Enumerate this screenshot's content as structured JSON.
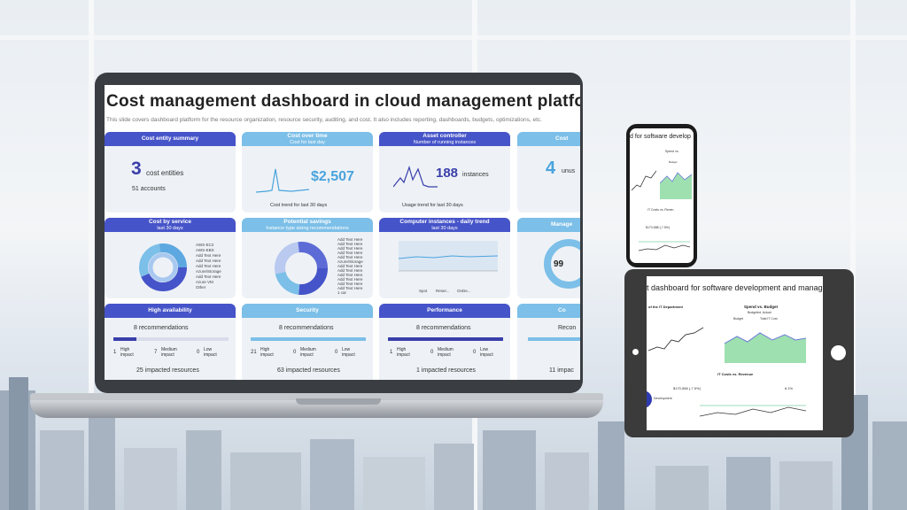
{
  "dashboard": {
    "title": "Cost management dashboard in cloud management platfo",
    "subtitle": "This slide covers dashboard platform for the resource organization, resource security, auditing, and cost. It also includes reporting, dashboards, budgets, optimizations, etc.",
    "cost_entity": {
      "header": "Cost entity summary",
      "count": "3",
      "count_label": "cost entities",
      "accounts": "51 accounts"
    },
    "cost_over_time": {
      "header": "Cost over time",
      "subheader": "Cost for last day",
      "value": "$2,507",
      "caption": "Cost trend for last 30 days"
    },
    "asset_controller": {
      "header": "Asset controller",
      "subheader": "Number of running instances",
      "value": "188",
      "value_label": "instances",
      "caption": "Usage trend for last 30 days"
    },
    "cost_partial": {
      "header": "Cost",
      "value": "4",
      "value_label": "unus"
    },
    "cost_by_service": {
      "header": "Cost by service",
      "subheader": "last 30 days",
      "legend": [
        "AWS-EC2",
        "AWS-EBS",
        "Add Text Here",
        "Add Text Here",
        "Add Text Here",
        "Azure/Storage",
        "Add Text Here",
        "Azure VM",
        "Other"
      ]
    },
    "potential_savings": {
      "header": "Potential savings",
      "subheader": "Instance type sizing recommendations",
      "legend": [
        "Add Text Here",
        "Add Text Here",
        "Add Text Here",
        "Add Text Here",
        "Add Text Here",
        "Azure/Storage",
        "Add Text Here",
        "Add Text Here",
        "Add Text Here",
        "Add Text Here",
        "Add Text Here",
        "Add Text Here",
        "Add Text Here",
        "1 car"
      ]
    },
    "computer_instances": {
      "header": "Computer instances - daily trend",
      "subheader": "last 30 days",
      "legend_spot": "Spot",
      "legend_reserved": "Reser...",
      "legend_ondemand": "OnDe..."
    },
    "manage_partial": {
      "header": "Manage",
      "value": "99"
    },
    "high_availability": {
      "header": "High availability",
      "recommendations": "8 recommendations",
      "high_count": "1",
      "high_label": "High impact",
      "medium_count": "7",
      "medium_label": "Medium impact",
      "low_count": "0",
      "low_label": "Low impact",
      "impacted": "25 impacted resources",
      "progress": 0.2
    },
    "security": {
      "header": "Security",
      "recommendations": "8 recommendations",
      "high_count": "21",
      "high_label": "High impact",
      "medium_count": "0",
      "medium_label": "Medium impact",
      "low_count": "0",
      "low_label": "Low impact",
      "impacted": "63 impacted resources",
      "progress": 0.0
    },
    "performance": {
      "header": "Performance",
      "recommendations": "8 recommendations",
      "high_count": "1",
      "high_label": "High impact",
      "medium_count": "0",
      "medium_label": "Medium impact",
      "low_count": "0",
      "low_label": "Low impact",
      "impacted": "1 impacted resources",
      "progress": 1.0
    },
    "cost_partial_bottom": {
      "header": "Co",
      "recommendations": "Recon",
      "impacted": "11 impac"
    }
  },
  "phone": {
    "title": "d for software develop",
    "chart_label": "Spend vs.",
    "legend_budget": "Budget",
    "section_label": "IT Costs vs. Reven",
    "figure": "$170,588 (-7.5%)"
  },
  "tablet": {
    "title": "t dashboard for software development and manag",
    "section_left": "of the IT Department",
    "chart_title": "Spend vs. Budget",
    "chart_subtitle": "Budgeted, Actual",
    "legend_budget": "Budget",
    "legend_total": "Total IT Cost",
    "bottom_title": "IT Costs vs. Revenue",
    "figure_left": "$170,588 (-7.5%)",
    "figure_right": "8.1%",
    "development": "Development"
  },
  "colors": {
    "accent_dark": "#4654c9",
    "accent_light": "#7cbfe8",
    "card_bg": "#eef2f6",
    "number": "#3a3faa",
    "value_light": "#4aa3dd"
  }
}
